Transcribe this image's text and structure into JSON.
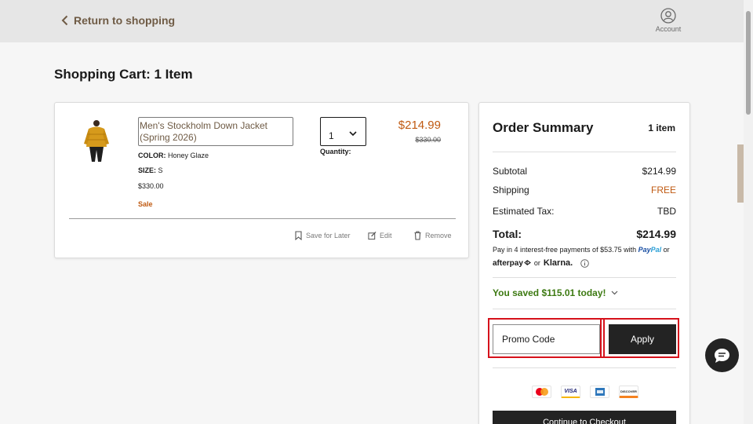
{
  "header": {
    "return_label": "Return to shopping",
    "account_label": "Account"
  },
  "page_title": "Shopping Cart: 1 Item",
  "cart_item": {
    "name": "Men's Stockholm Down Jacket (Spring 2026)",
    "color_label": "COLOR:",
    "color_value": "Honey Glaze",
    "size_label": "SIZE:",
    "size_value": "S",
    "unit_price": "$330.00",
    "sale_label": "Sale",
    "quantity": "1",
    "quantity_label": "Quantity:",
    "price": "$214.99",
    "original_price": "$330.00",
    "actions": {
      "save": "Save for Later",
      "edit": "Edit",
      "remove": "Remove"
    }
  },
  "summary": {
    "title": "Order Summary",
    "count": "1 item",
    "subtotal_label": "Subtotal",
    "subtotal_value": "$214.99",
    "shipping_label": "Shipping",
    "shipping_value": "FREE",
    "tax_label": "Estimated Tax:",
    "tax_value": "TBD",
    "total_label": "Total:",
    "total_value": "$214.99",
    "installments_text": "Pay in 4 interest-free payments of $53.75 with",
    "paypal_pay": "Pay",
    "paypal_pal": "Pal",
    "or_1": "or",
    "afterpay": "afterpay",
    "or_2": "or",
    "klarna": "Klarna.",
    "saved_text": "You saved $115.01 today!",
    "promo_placeholder": "Promo Code",
    "apply_label": "Apply",
    "card_visa": "VISA",
    "card_discover": "DISCOVER",
    "checkout_label": "Continue to Checkout"
  },
  "colors": {
    "brand_brown": "#6f5b45",
    "sale_orange": "#c05a12",
    "savings_green": "#3d7a12",
    "dark_button": "#232323",
    "highlight_red": "#d6111b"
  }
}
